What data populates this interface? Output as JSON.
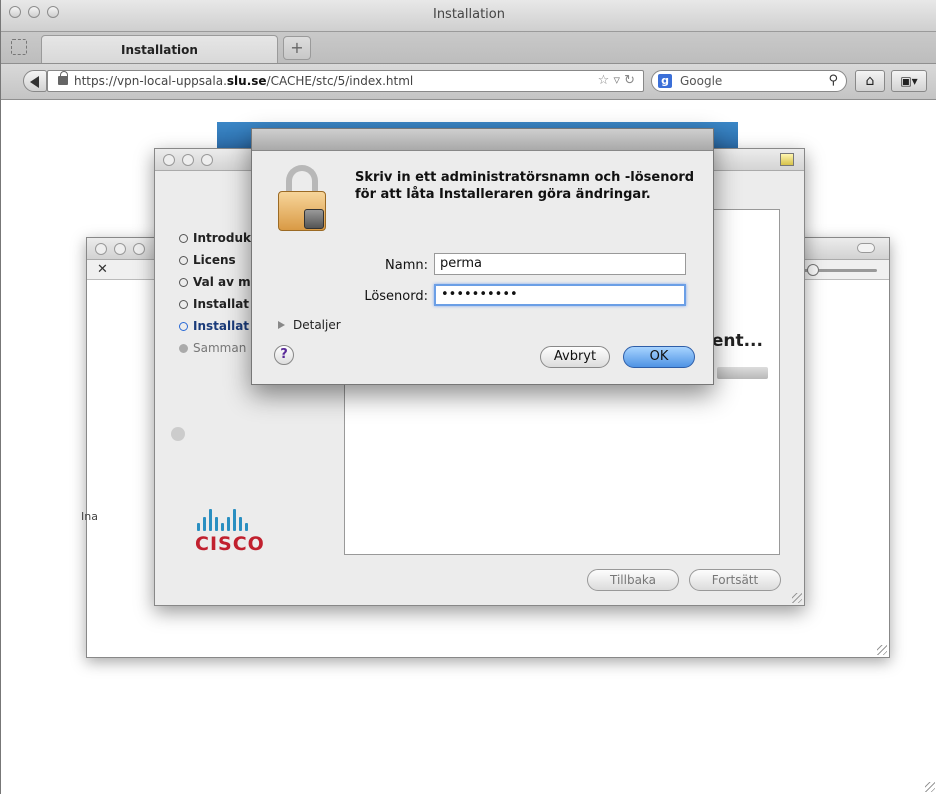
{
  "window": {
    "title": "Installation"
  },
  "tabs": [
    {
      "label": "Installation"
    }
  ],
  "nav": {
    "url_prefix": "https://vpn-local-uppsala.",
    "url_domain": "slu.se",
    "url_suffix": "/CACHE/stc/5/index.html",
    "search_placeholder": "Google"
  },
  "installer": {
    "steps": [
      {
        "label": "Introduk",
        "state": "done"
      },
      {
        "label": "Licens",
        "state": "done"
      },
      {
        "label": "Val av m",
        "state": "done"
      },
      {
        "label": "Installat",
        "state": "done"
      },
      {
        "label": "Installat",
        "state": "current"
      },
      {
        "label": "Samman",
        "state": "pending"
      }
    ],
    "heading": "ient...",
    "back_button": "Tillbaka",
    "continue_button": "Fortsätt",
    "logo_text": "CISCO"
  },
  "background_window": {
    "side_label": "Ina"
  },
  "dialog": {
    "prompt_line1": "Skriv in ett administratörsnamn och -lösenord",
    "prompt_line2": "för att låta Installeraren göra ändringar.",
    "name_label": "Namn:",
    "name_value": "perma",
    "password_label": "Lösenord:",
    "password_value": "••••••••••",
    "details_label": "Detaljer",
    "help_label": "?",
    "cancel_button": "Avbryt",
    "ok_button": "OK"
  },
  "colors": {
    "accent_blue": "#4f93e4",
    "cisco_red": "#c1202e",
    "cisco_blue": "#2a8fc1",
    "banner_blue": "#2a6aa8"
  }
}
